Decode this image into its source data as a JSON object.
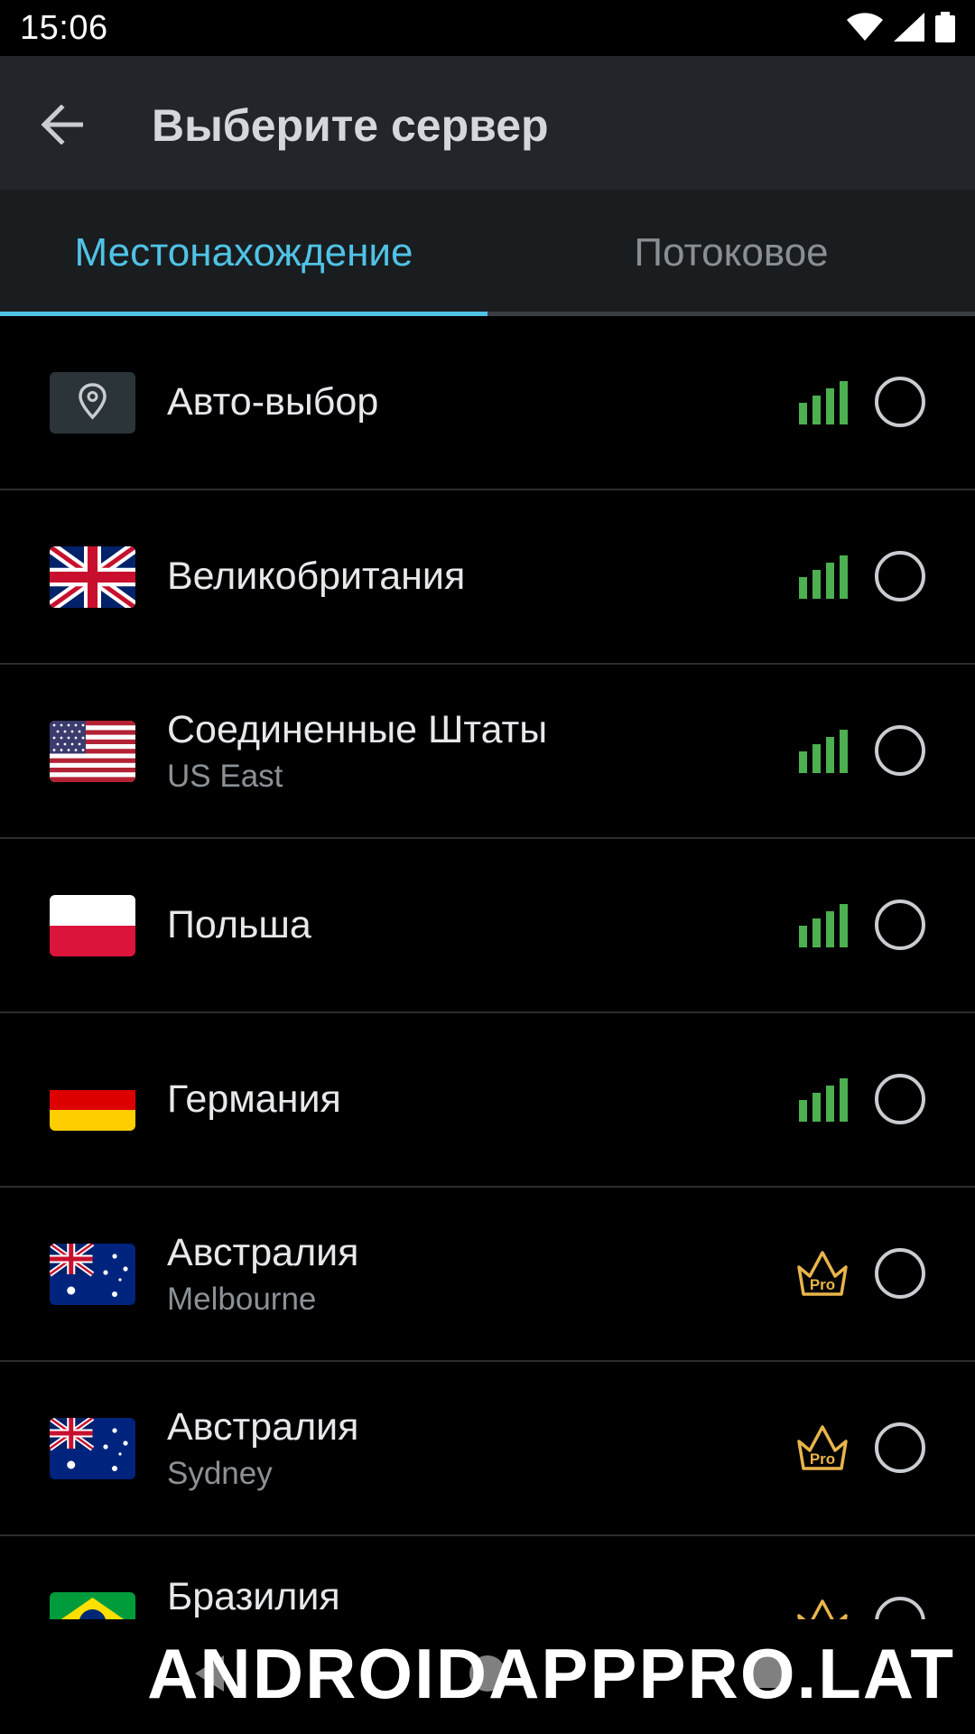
{
  "status_bar": {
    "time": "15:06"
  },
  "app_bar": {
    "title": "Выберите сервер"
  },
  "tabs": [
    {
      "label": "Местонахождение",
      "active": true
    },
    {
      "label": "Потоковое",
      "active": false
    }
  ],
  "servers": [
    {
      "name": "Авто-выбор",
      "sub": "",
      "flag": "location-pin",
      "badge": "signal"
    },
    {
      "name": "Великобритания",
      "sub": "",
      "flag": "uk",
      "badge": "signal"
    },
    {
      "name": "Соединенные Штаты",
      "sub": "US East",
      "flag": "us",
      "badge": "signal"
    },
    {
      "name": "Польша",
      "sub": "",
      "flag": "pl",
      "badge": "signal"
    },
    {
      "name": "Германия",
      "sub": "",
      "flag": "de",
      "badge": "signal"
    },
    {
      "name": "Австралия",
      "sub": "Melbourne",
      "flag": "au",
      "badge": "pro"
    },
    {
      "name": "Австралия",
      "sub": "Sydney",
      "flag": "au",
      "badge": "pro"
    },
    {
      "name": "Бразилия",
      "sub": "",
      "flag": "br",
      "badge": "pro"
    }
  ],
  "badges": {
    "pro_label": "Pro"
  },
  "watermark": "ANDROIDAPPPRO.LAT",
  "colors": {
    "accent": "#4fc3e6",
    "signal_green": "#4caf50",
    "pro_gold": "#e8b54a",
    "app_bar": "#22262a"
  }
}
